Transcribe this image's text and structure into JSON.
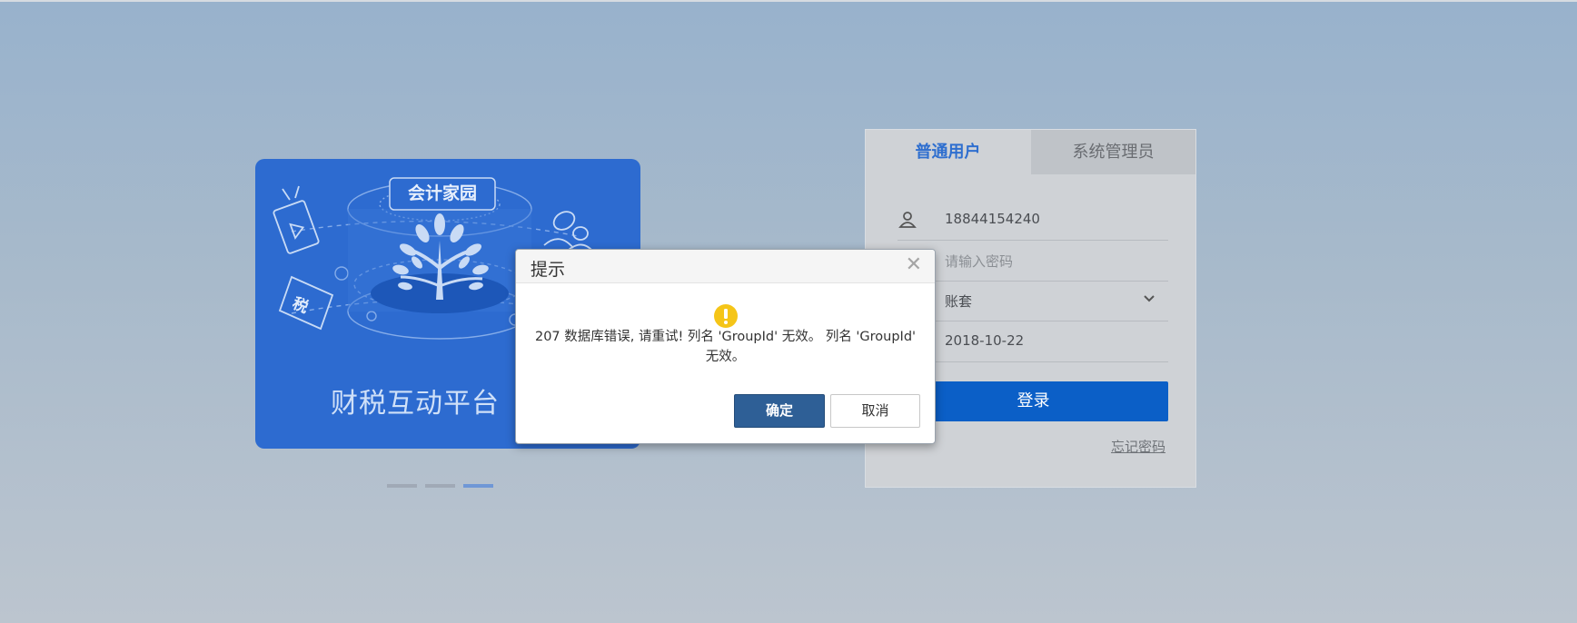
{
  "banner": {
    "badge": "会计家园",
    "tax_tag": "税",
    "title": "财税互动平台",
    "carousel_active_index": 2,
    "carousel_count": 3
  },
  "login": {
    "tabs": [
      {
        "label": "普通用户",
        "active": true
      },
      {
        "label": "系统管理员",
        "active": false
      }
    ],
    "username": "18844154240",
    "password_placeholder": "请输入密码",
    "account_set": "账套",
    "date": "2018-10-22",
    "login_button": "登录",
    "forgot_link": "忘记密码"
  },
  "dialog": {
    "title": "提示",
    "message": "207 数据库错误, 请重试! 列名 'GroupId' 无效。 列名 'GroupId' 无效。",
    "ok_label": "确定",
    "cancel_label": "取消"
  },
  "colors": {
    "banner_bg": "#2d6bd0",
    "primary_button": "#0b5fc7",
    "active_tab_text": "#2f6fcf",
    "dialog_ok": "#2e5f96",
    "warning_icon": "#f5c518"
  }
}
